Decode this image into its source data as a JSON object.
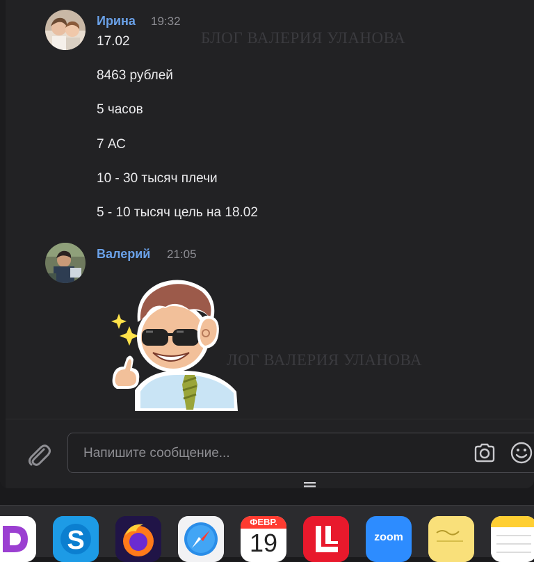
{
  "watermark": "БЛОГ ВАЛЕРИЯ УЛАНОВА",
  "watermark2": "ЛОГ ВАЛЕРИЯ УЛАНОВА",
  "messages": [
    {
      "author": "Ирина",
      "time": "19:32",
      "lines": [
        "17.02",
        "8463 рублей",
        "5 часов",
        "7 АС",
        "10 - 30 тысяч плечи",
        "5 - 10 тысяч цель на 18.02"
      ]
    },
    {
      "author": "Валерий",
      "time": "21:05",
      "sticker": "sunglasses-guy-sticker"
    }
  ],
  "composer": {
    "placeholder": "Напишите сообщение..."
  },
  "dock": {
    "calendar_month": "ФЕВР.",
    "calendar_day": "19",
    "zoom_label": "zoom",
    "skype_label": "S",
    "apps": [
      "app-d-icon",
      "skype-icon",
      "firefox-icon",
      "safari-icon",
      "calendar-icon",
      "lasso-icon",
      "zoom-icon",
      "stickies-icon",
      "notes-icon"
    ]
  },
  "colors": {
    "author": "#6aa1e8",
    "background": "#222224",
    "text": "#ececee"
  }
}
